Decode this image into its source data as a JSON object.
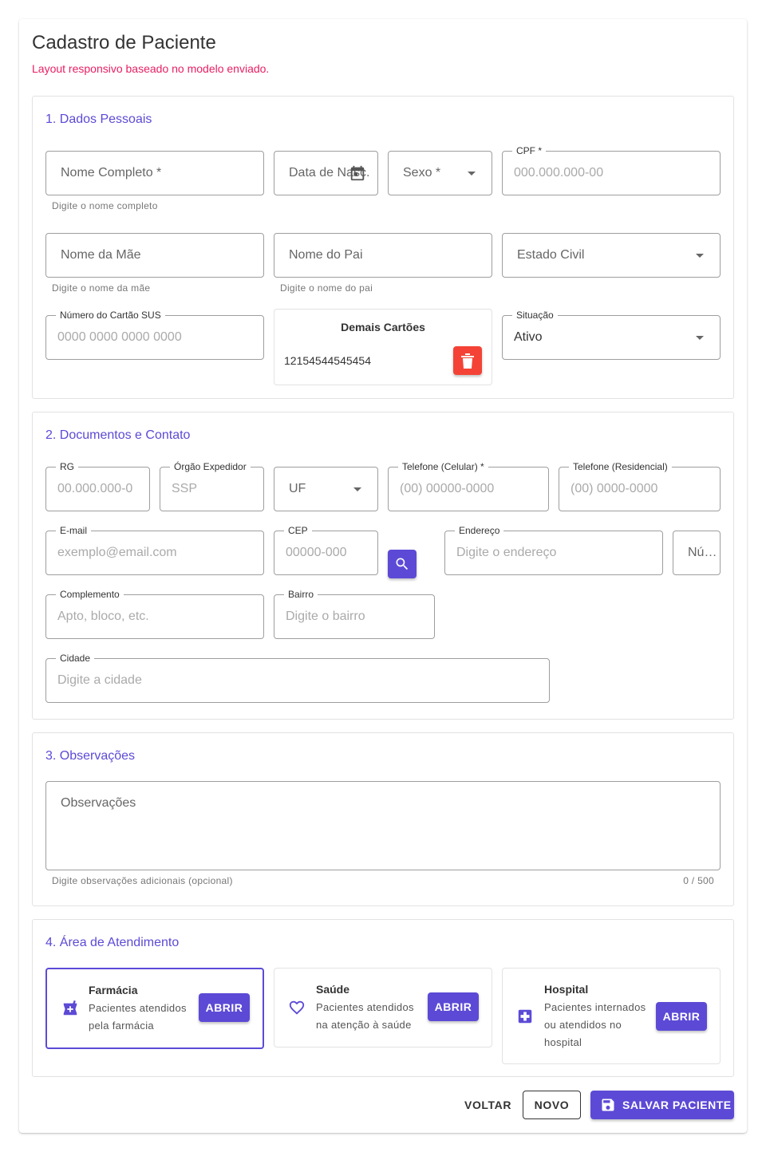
{
  "header": {
    "title": "Cadastro de Paciente",
    "subtitle": "Layout responsivo baseado no modelo enviado."
  },
  "section1": {
    "title": "1. Dados Pessoais",
    "nome_completo": {
      "placeholder": "Nome Completo *",
      "hint": "Digite o nome completo"
    },
    "data_nasc": {
      "placeholder": "Data de Nasc."
    },
    "sexo": {
      "placeholder": "Sexo *"
    },
    "cpf": {
      "label": "CPF *",
      "placeholder": "000.000.000-00"
    },
    "nome_mae": {
      "placeholder": "Nome da Mãe",
      "hint": "Digite o nome da mãe"
    },
    "nome_pai": {
      "placeholder": "Nome do Pai",
      "hint": "Digite o nome do pai"
    },
    "estado_civil": {
      "placeholder": "Estado Civil"
    },
    "cartao_sus": {
      "label": "Número do Cartão SUS",
      "placeholder": "0000 0000 0000 0000"
    },
    "demais_cartoes": {
      "title": "Demais Cartões",
      "items": [
        "12154544545454"
      ]
    },
    "situacao": {
      "label": "Situação",
      "value": "Ativo"
    }
  },
  "section2": {
    "title": "2. Documentos e Contato",
    "rg": {
      "label": "RG",
      "placeholder": "00.000.000-0"
    },
    "orgao": {
      "label": "Órgão Expedidor",
      "placeholder": "SSP"
    },
    "uf": {
      "placeholder": "UF"
    },
    "tel_celular": {
      "label": "Telefone (Celular) *",
      "placeholder": "(00) 00000-0000"
    },
    "tel_residencial": {
      "label": "Telefone (Residencial)",
      "placeholder": "(00) 0000-0000"
    },
    "email": {
      "label": "E-mail",
      "placeholder": "exemplo@email.com"
    },
    "cep": {
      "label": "CEP",
      "placeholder": "00000-000"
    },
    "endereco": {
      "label": "Endereço",
      "placeholder": "Digite o endereço"
    },
    "numero": {
      "placeholder": "Nú…"
    },
    "complemento": {
      "label": "Complemento",
      "placeholder": "Apto, bloco, etc."
    },
    "bairro": {
      "label": "Bairro",
      "placeholder": "Digite o bairro"
    },
    "cidade": {
      "label": "Cidade",
      "placeholder": "Digite a cidade"
    }
  },
  "section3": {
    "title": "3. Observações",
    "placeholder": "Observações",
    "hint": "Digite observações adicionais (opcional)",
    "counter": "0 / 500"
  },
  "section4": {
    "title": "4. Área de Atendimento",
    "cards": [
      {
        "title": "Farmácia",
        "desc_lines": [
          "Pacientes atendidos",
          "pela farmácia"
        ],
        "button": "ABRIR",
        "icon": "pharmacy-icon"
      },
      {
        "title": "Saúde",
        "desc_lines": [
          "Pacientes atendidos",
          "na atenção à saúde"
        ],
        "button": "ABRIR",
        "icon": "heart-icon"
      },
      {
        "title": "Hospital",
        "desc_lines": [
          "Pacientes internados",
          "ou atendidos no",
          "hospital"
        ],
        "button": "ABRIR",
        "icon": "hospital-icon"
      }
    ]
  },
  "footer": {
    "voltar": "VOLTAR",
    "novo": "NOVO",
    "salvar": "SALVAR PACIENTE"
  },
  "colors": {
    "accent": "#5c4ad6",
    "subtitle": "#e91e63",
    "danger": "#f44336"
  }
}
